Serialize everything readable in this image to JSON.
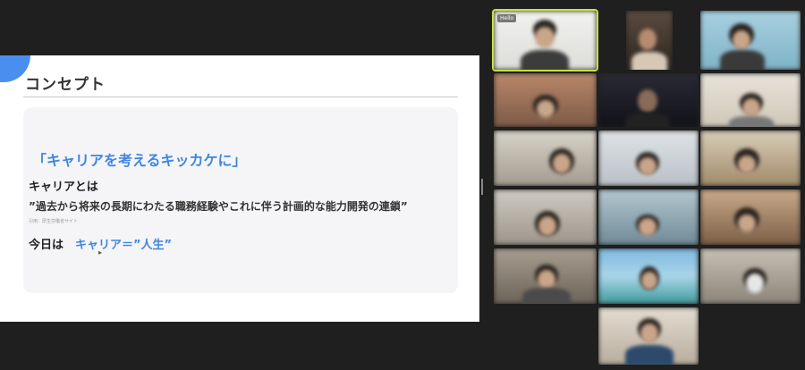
{
  "slide": {
    "title": "コンセプト",
    "headline": "「キャリアを考えるキッカケに」",
    "label": "キャリアとは",
    "quote": "”過去から将来の長期にわたる職務経験やこれに伴う計画的な能力開発の連鎖”",
    "source": "引用：厚生労働省サイト",
    "today_label": "今日は",
    "today_value": "キャリア＝”人生”",
    "accent_color": "#3f86e0"
  },
  "participants": [
    {
      "id": "p1",
      "name": "",
      "badge": "Hello",
      "active": true
    },
    {
      "id": "p2",
      "name": ""
    },
    {
      "id": "p3",
      "name": ""
    },
    {
      "id": "p4",
      "name": ""
    },
    {
      "id": "p5",
      "name": ""
    },
    {
      "id": "p6",
      "name": ""
    },
    {
      "id": "p7",
      "name": ""
    },
    {
      "id": "p8",
      "name": ""
    },
    {
      "id": "p9",
      "name": ""
    },
    {
      "id": "p10",
      "name": ""
    },
    {
      "id": "p11",
      "name": ""
    },
    {
      "id": "p12",
      "name": ""
    },
    {
      "id": "p13",
      "name": ""
    },
    {
      "id": "p14",
      "name": ""
    },
    {
      "id": "p15",
      "name": ""
    },
    {
      "id": "p16",
      "name": ""
    }
  ]
}
